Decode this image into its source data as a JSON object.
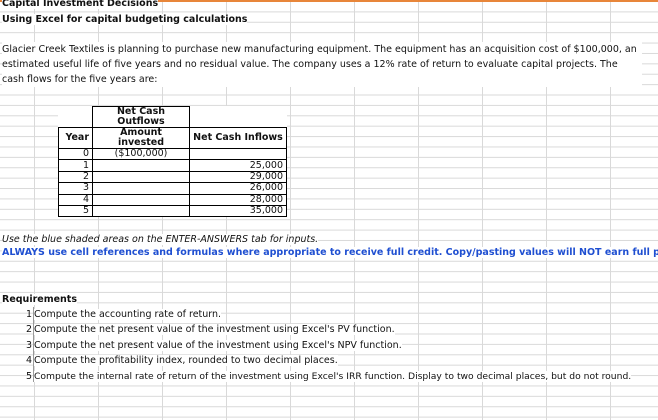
{
  "sheet": {
    "title": "Capital Investment Decisions",
    "subtitle": "Using Excel for capital budgeting calculations",
    "description": "Glacier Creek Textiles is planning to purchase new manufacturing equipment. The equipment has an acquisition cost of $100,000, an estimated useful life of five years and no residual value. The company uses a 12% rate of return to evaluate capital projects. The cash flows for the five years are:"
  },
  "table": {
    "header_year": "Year",
    "header_outflows_line1": "Net Cash Outflows",
    "header_outflows_line2": "Amount invested",
    "header_inflows": "Net Cash Inflows",
    "rows": [
      {
        "year": "0",
        "outflow": "($100,000)",
        "inflow": ""
      },
      {
        "year": "1",
        "outflow": "",
        "inflow": "25,000"
      },
      {
        "year": "2",
        "outflow": "",
        "inflow": "29,000"
      },
      {
        "year": "3",
        "outflow": "",
        "inflow": "26,000"
      },
      {
        "year": "4",
        "outflow": "",
        "inflow": "28,000"
      },
      {
        "year": "5",
        "outflow": "",
        "inflow": "35,000"
      }
    ]
  },
  "notes": {
    "inputs_note": "Use the blue shaded areas on the ENTER-ANSWERS tab for inputs.",
    "always_note": "ALWAYS use cell references and formulas where appropriate to receive full credit. Copy/pasting values will NOT earn full points."
  },
  "requirements": {
    "heading": "Requirements",
    "items": [
      {
        "num": "1",
        "text": "Compute the accounting rate of return."
      },
      {
        "num": "2",
        "text": "Compute the net present value of the investment using Excel's PV function."
      },
      {
        "num": "3",
        "text": "Compute the net present value of the investment using Excel's NPV function."
      },
      {
        "num": "4",
        "text": "Compute the profitability index, rounded to two decimal places."
      },
      {
        "num": "5",
        "text": "Compute the internal rate of return of the investment using Excel's IRR function. Display to two decimal places, but do not round."
      }
    ]
  }
}
